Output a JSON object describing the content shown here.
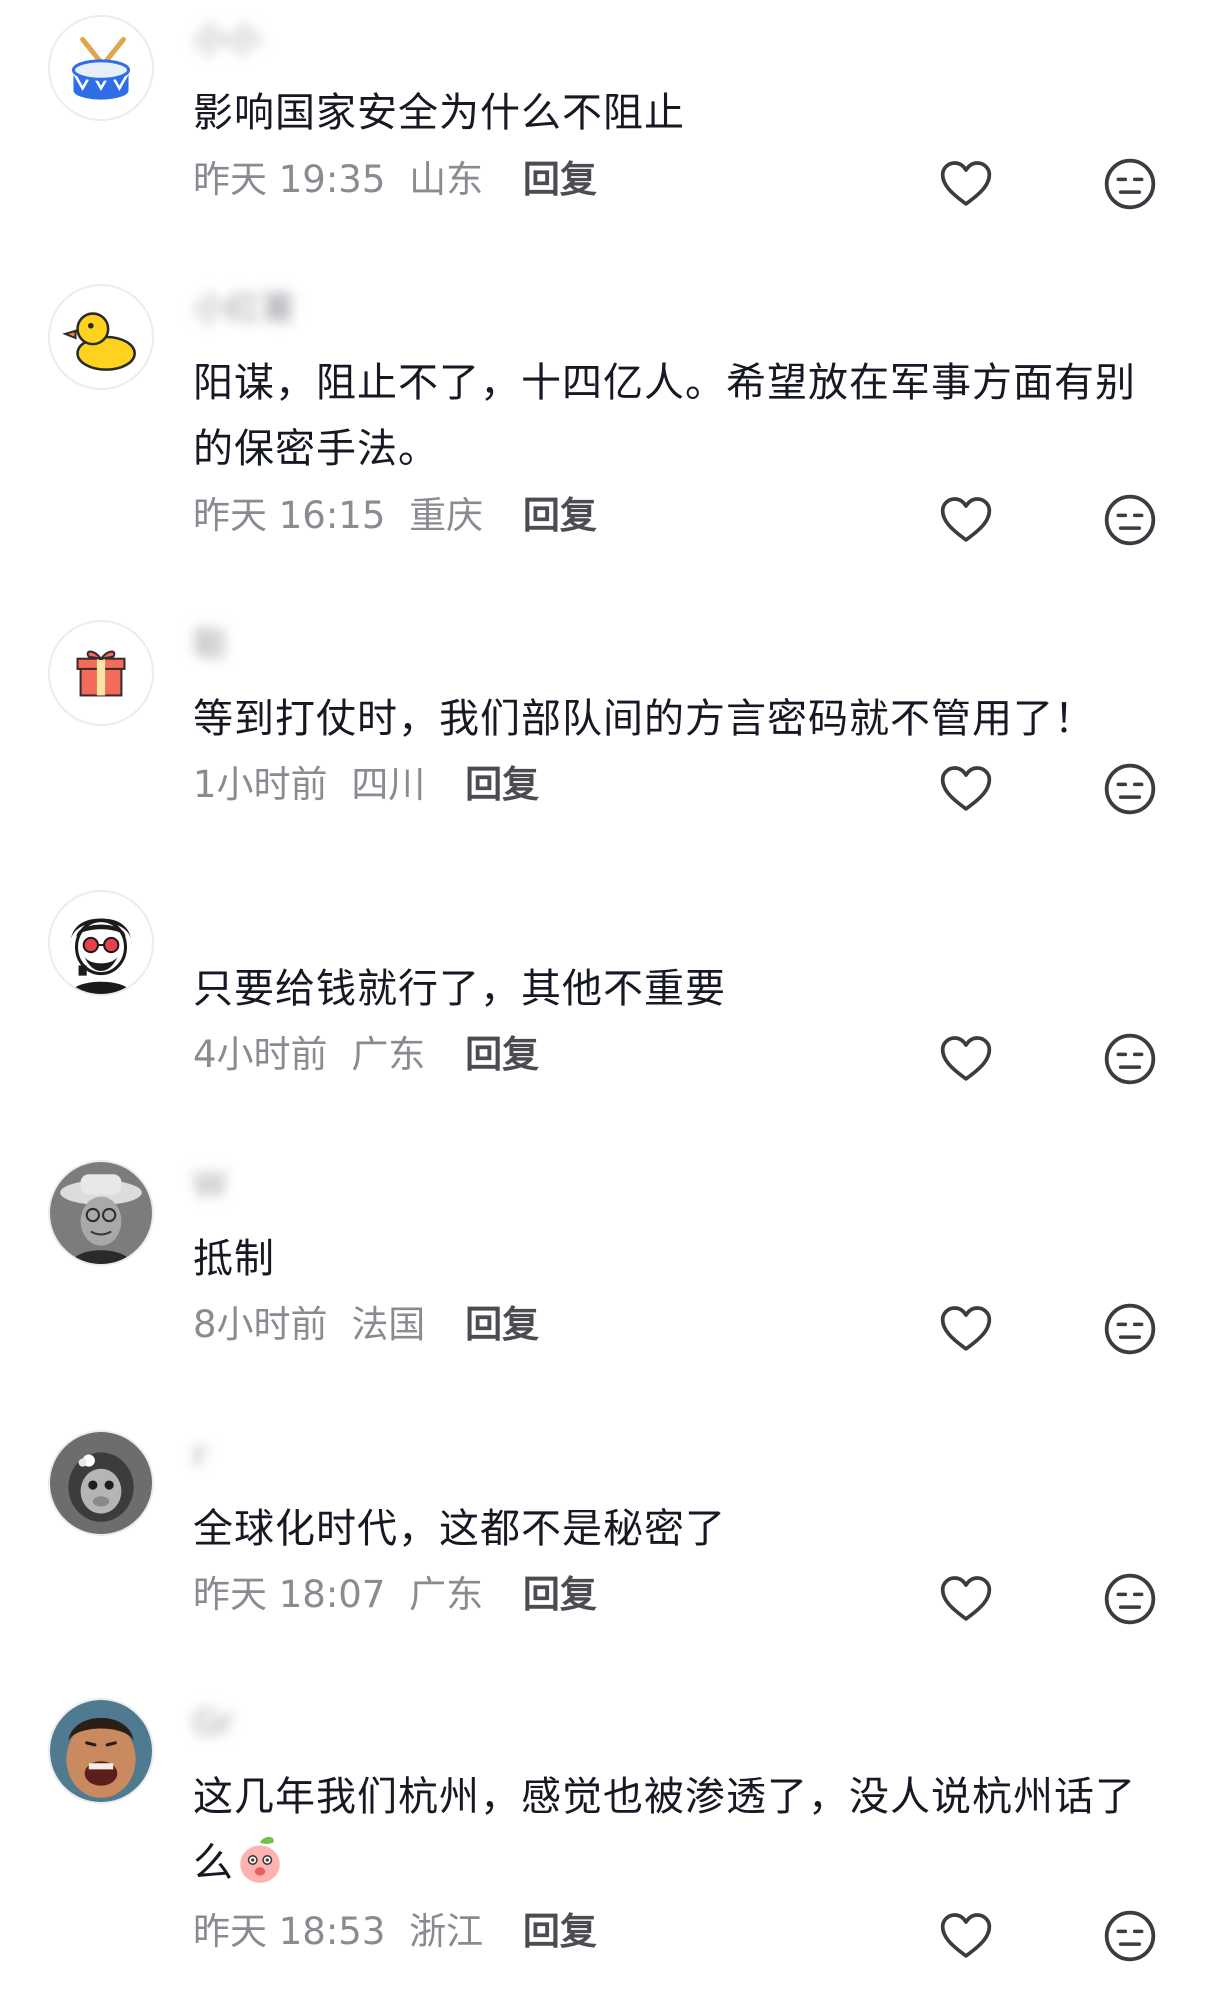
{
  "comments": [
    {
      "username": "小小",
      "avatar_icon": "drum-icon",
      "text": "影响国家安全为什么不阻止",
      "time": "昨天 19:35",
      "location": "山东",
      "reply_label": "回复"
    },
    {
      "username": "小红薯",
      "avatar_icon": "duck-icon",
      "text": "阳谋，阻止不了，十四亿人。希望放在军事方面有别的保密手法。",
      "time": "昨天 16:15",
      "location": "重庆",
      "reply_label": "回复"
    },
    {
      "username": "聪",
      "avatar_icon": "gift-icon",
      "text": "等到打仗时，我们部队间的方言密码就不管用了！",
      "time": "1小时前",
      "location": "四川",
      "reply_label": "回复"
    },
    {
      "username": "",
      "avatar_icon": "cartoon-man-icon",
      "text": "只要给钱就行了，其他不重要",
      "time": "4小时前",
      "location": "广东",
      "reply_label": "回复"
    },
    {
      "username": "W",
      "avatar_icon": "man-with-hat-photo",
      "text": "抵制",
      "time": "8小时前",
      "location": "法国",
      "reply_label": "回复"
    },
    {
      "username": "r",
      "avatar_icon": "monkey-photo",
      "text": "全球化时代，这都不是秘密了",
      "time": "昨天 18:07",
      "location": "广东",
      "reply_label": "回复"
    },
    {
      "username": "Gr",
      "avatar_icon": "laughing-man-photo",
      "text": "这几年我们杭州，感觉也被渗透了，没人说杭州话了么",
      "time": "昨天 18:53",
      "location": "浙江",
      "reply_label": "回复"
    }
  ]
}
